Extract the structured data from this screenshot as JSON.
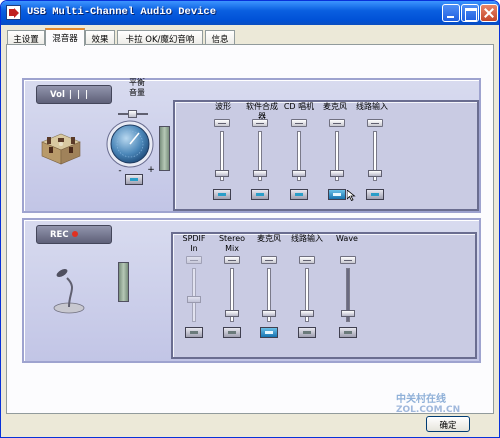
{
  "window": {
    "title": "USB Multi-Channel Audio Device",
    "controls": [
      "minimize",
      "maximize",
      "close"
    ]
  },
  "tabs": [
    {
      "label": "主设置",
      "active": false
    },
    {
      "label": "混音器",
      "active": true
    },
    {
      "label": "效果",
      "active": false
    },
    {
      "label": "卡拉 OK/魔幻音响",
      "active": false
    },
    {
      "label": "信息",
      "active": false
    }
  ],
  "playback": {
    "badge": "Vol",
    "balance_label": "平衡\n音量",
    "knob_signs": {
      "minus": "-",
      "plus": "+"
    },
    "channels": [
      {
        "label": "波形",
        "level": 0.1,
        "muted": false
      },
      {
        "label": "软件合成\n器",
        "level": 0.1,
        "muted": false
      },
      {
        "label": "CD 唱机",
        "level": 0.1,
        "muted": false
      },
      {
        "label": "麦克风",
        "level": 0.1,
        "muted": true
      },
      {
        "label": "线路输入",
        "level": 0.1,
        "muted": false
      }
    ]
  },
  "recording": {
    "badge": "REC",
    "channels": [
      {
        "label": "SPDIF\nIn",
        "level": 0.4,
        "muted": false,
        "disabled": true
      },
      {
        "label": "Stereo\nMix",
        "level": 0.1,
        "muted": false
      },
      {
        "label": "麦克风",
        "level": 0.1,
        "muted": false,
        "selected": true
      },
      {
        "label": "线路输入",
        "level": 0.1,
        "muted": false
      },
      {
        "label": "Wave",
        "level": 0.1,
        "muted": false
      }
    ]
  },
  "footer": {
    "ok_label": "确定"
  },
  "watermark": {
    "line1": "中关村在线",
    "line2": "ZOL.COM.CN"
  },
  "colors": {
    "titlebar": "#0a5fe0",
    "panel": "#c9cbe3",
    "group": "#d0d3ec",
    "mute_active": "#1874b0"
  }
}
